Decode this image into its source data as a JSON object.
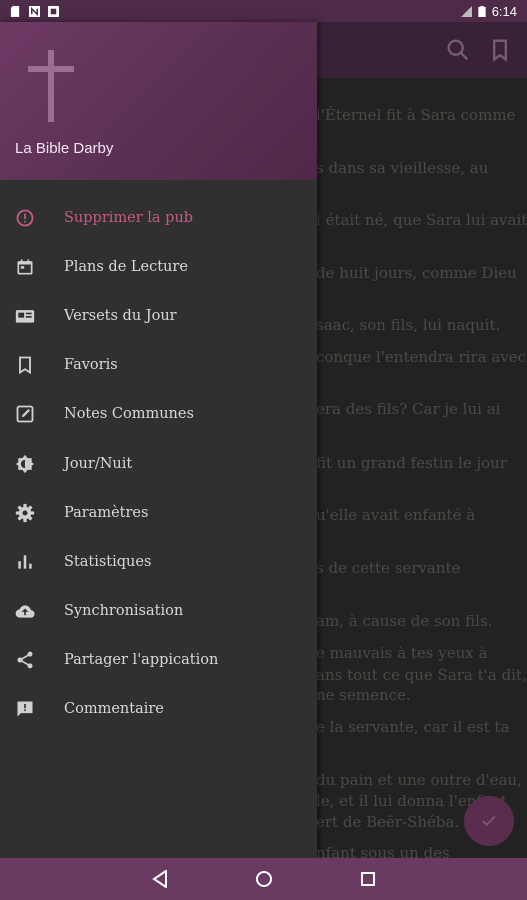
{
  "status": {
    "time": "6:14"
  },
  "content": {
    "lines": [
      "l'Éternel fit à Sara comme",
      "s dans sa vieillesse, au",
      "i était né, que Sara lui avait",
      "de huit jours, comme Dieu",
      "saac, son fils, lui naquit.",
      "conque l'entendra rira avec",
      "era des fils? Car je lui ai",
      "fit un grand festin le jour",
      "u'elle avait enfanté à",
      "s de cette servante",
      "am, à cause de son fils.",
      "e mauvais à tes yeux à",
      "ans tout ce que Sara t'a dit,",
      "ne semence.",
      "e la servante, car il est ta",
      "du pain et une outre d'eau,",
      "le, et il lui donna l'enfant",
      "ert de Beër-Shéba.",
      "nfant sous un des"
    ]
  },
  "drawer": {
    "title": "La Bible Darby",
    "items": [
      {
        "label": "Supprimer la pub",
        "icon": "info-icon",
        "accent": true
      },
      {
        "label": "Plans de Lecture",
        "icon": "calendar-icon"
      },
      {
        "label": "Versets du Jour",
        "icon": "verse-card-icon"
      },
      {
        "label": "Favoris",
        "icon": "bookmark-icon"
      },
      {
        "label": "Notes Communes",
        "icon": "edit-note-icon"
      },
      {
        "label": "Jour/Nuit",
        "icon": "brightness-icon"
      },
      {
        "label": "Paramètres",
        "icon": "gear-icon"
      },
      {
        "label": "Statistiques",
        "icon": "bar-chart-icon"
      },
      {
        "label": "Synchronisation",
        "icon": "cloud-upload-icon"
      },
      {
        "label": "Partager l'appication",
        "icon": "share-icon"
      },
      {
        "label": "Commentaire",
        "icon": "comment-icon"
      }
    ]
  },
  "colors": {
    "accent": "#c45a86",
    "primary": "#6b3a63"
  }
}
